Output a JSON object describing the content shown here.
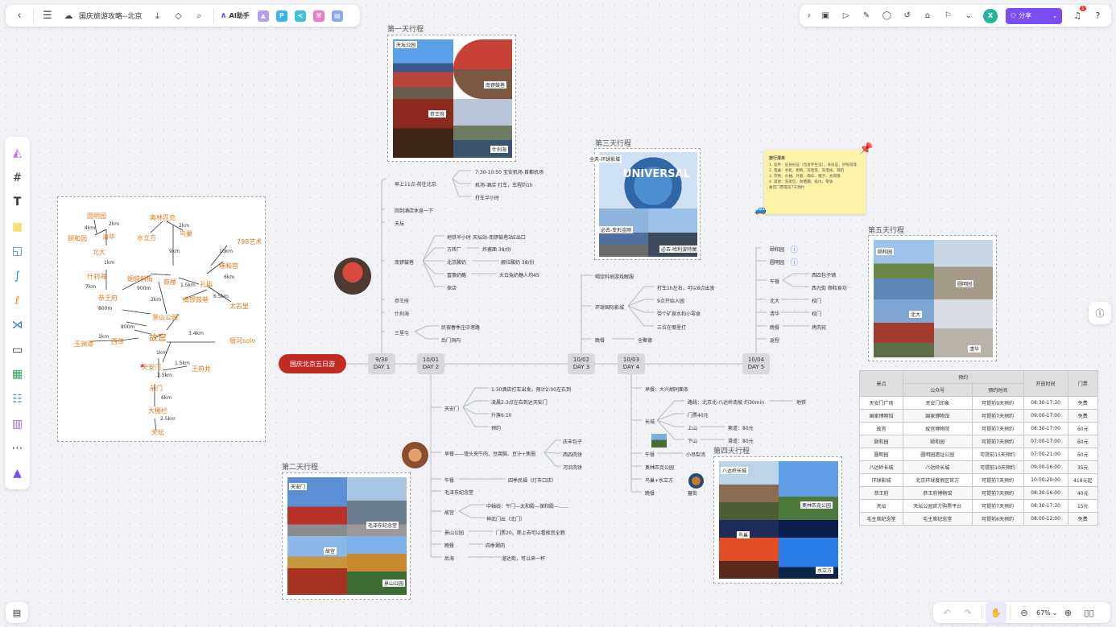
{
  "doc": {
    "title": "国庆旅游攻略--北京"
  },
  "toolbar": {
    "ai_label": "AI助手",
    "share_label": "分享",
    "avatar_letter": "X",
    "notification_count": "1"
  },
  "zoom": {
    "value": "67%"
  },
  "frames": {
    "day1": "第一天行程",
    "day2": "第二天行程",
    "day3": "第三天行程",
    "day4": "第四天行程",
    "day5": "第五天行程"
  },
  "photos": {
    "d1": [
      "天坛公园",
      "南锣鼓巷",
      "恭王府",
      "什刹海"
    ],
    "d2": [
      "天安门",
      "毛泽东纪念堂",
      "故宫",
      "景山公园"
    ],
    "d3": [
      "全天-环球影城",
      "必去-变形金刚",
      "必去-哈利波特魔法世界"
    ],
    "d4": [
      "八达岭长城",
      "奥林匹克公园",
      "鸟巢",
      "水立方"
    ],
    "d5": [
      "颐和园",
      "圆明园",
      "北大",
      "清华"
    ]
  },
  "sticky": {
    "title": "旅行清单",
    "l1": "1. 证件：证身份证（包含学生证），身份证、护照等等",
    "l2": "2. 电器：手机、相机、充电宝、充电线、耳机",
    "l3": "3. 衣物：长袖、外套、雨伞、帽子、太阳镜",
    "l4": "4. 其他：洗漱包、防晒霜、纸巾、零食",
    "l5": "故宫门票提前7天预约"
  },
  "hand": {
    "nodes": [
      "圆明园",
      "奥林匹克",
      "颐和园",
      "清华",
      "水立方",
      "鸟巢",
      "北大",
      "798艺术",
      "什刹海",
      "烟袋斜街",
      "鼓楼",
      "雍和宫",
      "恭王府",
      "孔庙",
      "南锣鼓巷",
      "太古里",
      "景山公园",
      "故宫",
      "玉渊潭",
      "西单",
      "银河solo",
      "天安门",
      "王府井",
      "前门",
      "大栅栏",
      "天坛"
    ],
    "dists": [
      "4km",
      "2km",
      "9km",
      "1km",
      "10km",
      "2km",
      "1.5km",
      "6km",
      "7km",
      "900m",
      "2km",
      "800m",
      "6.5km",
      "800m",
      "3.4km",
      "1km",
      "1km",
      "2.5km",
      "1.5km",
      "6km",
      "2.5km"
    ]
  },
  "mindmap": {
    "root": "国庆北京五日游",
    "days": [
      {
        "date": "9/30",
        "label": "DAY 1"
      },
      {
        "date": "10/01",
        "label": "DAY 2"
      },
      {
        "date": "10/02",
        "label": "DAY 3"
      },
      {
        "date": "10/03",
        "label": "DAY 4"
      },
      {
        "date": "10/04",
        "label": "DAY 5"
      }
    ],
    "d1": [
      "早上11点-前往北京",
      "回到酒店休息一下",
      "天坛",
      "南锣鼓巷",
      "恭王府",
      "什刹海",
      "三里屯"
    ],
    "d1a": [
      "7:30-10:50 宝安机场-首都机场",
      "机场-酒店 打车，车程约1h",
      "打车半小时"
    ],
    "d1b": [
      "地铁半小时 天坛站-南锣鼓巷站E出口",
      "方砖厂",
      "北京酸奶",
      "富豪奶酪",
      "探店"
    ],
    "d1c": [
      "炸酱面 38/份",
      "娜拉酸奶 38/份",
      "大白兔奶糖人均45"
    ],
    "d1d": [
      "民宿春季庄中港路",
      "后门洞内"
    ],
    "d2": [
      "天安门",
      "早餐——馒头夹牛肉、豆腐脑、豆汁+焦圈",
      "午餐",
      "毛泽东纪念堂",
      "故宫",
      "景山公园",
      "晚餐",
      "后海"
    ],
    "d2a": [
      "1:30酒店打车出发，预计2:00左右到",
      "凌晨2-3点左右到达天安门",
      "升旗6:10",
      "预约"
    ],
    "d2b": [
      "庆丰包子",
      "西四肉饼",
      "河沿肉饼"
    ],
    "d2c": [
      "四季民福（灯市口店）",
      "中轴线：午门—太和殿—保和殿—……",
      "神武门出（北门）",
      "门票20。爬上去可以看故宫全貌",
      "四季涮肉",
      "溜达街，可以来一杯"
    ],
    "d3": [
      "喝饮料刷游戏眼服",
      "环球国际影城",
      "晚餐"
    ],
    "d3a": [
      "打车1h左右，可以8点出发",
      "9点开始入园",
      "带个矿泉水和小零食",
      "三位在哪里打"
    ],
    "d3b": [
      "全聚德"
    ],
    "d4": [
      "早餐：大兴胡同面条",
      "长城",
      "午餐",
      "奥林匹克公园",
      "鸟巢+水立方",
      "晚餐"
    ],
    "d4a": [
      "路线：北京北-八达岭南坡 约30min",
      "门票40元",
      "上山",
      "下山",
      "地铁",
      "小吊梨汤",
      "簋街"
    ],
    "d4b": [
      "索道：80元",
      "滑道：80元"
    ],
    "d5": [
      "颐和园",
      "圆明园",
      "午餐",
      "北大",
      "清华",
      "晚餐",
      "返程"
    ],
    "d5a": [
      "西四包子铺",
      "西九街 顺和食坊",
      "校门",
      "校门",
      "烤肉宛"
    ]
  },
  "table": {
    "headers": [
      "景点",
      "预约",
      "开放时间",
      "门票"
    ],
    "sub": [
      "公众号",
      "预约时间"
    ],
    "rows": [
      [
        "天安门广场",
        "天安门印象",
        "可提前9天预约",
        "08:30-17:30",
        "免费"
      ],
      [
        "国家博物馆",
        "国家博物馆",
        "可提前7天预约",
        "09:00-17:00",
        "免费"
      ],
      [
        "故宫",
        "故宫博物院",
        "可提前7天预约",
        "08:30-17:00",
        "60元"
      ],
      [
        "颐和园",
        "颐和园",
        "可提前7天预约",
        "07:00-17:00",
        "60元"
      ],
      [
        "圆明园",
        "圆明园遗址公园",
        "可提前15天预约",
        "07:00-21:00",
        "60元"
      ],
      [
        "八达岭长城",
        "八达岭长城",
        "可提前10天预约",
        "09:00-16:00",
        "35元"
      ],
      [
        "环球影城",
        "北京环球度假区官方",
        "可提前7天预约",
        "10:00-20:00",
        "418元起"
      ],
      [
        "恭王府",
        "恭王府博物馆",
        "可提前7天预约",
        "08:30-16:00",
        "40元"
      ],
      [
        "天坛",
        "天坛公园官方购票平台",
        "可提前7天预约",
        "08:30-17:30",
        "15元"
      ],
      [
        "毛主席纪念堂",
        "毛主席纪念堂",
        "可提前6天预约",
        "08:00-12:00",
        "免费"
      ]
    ]
  }
}
